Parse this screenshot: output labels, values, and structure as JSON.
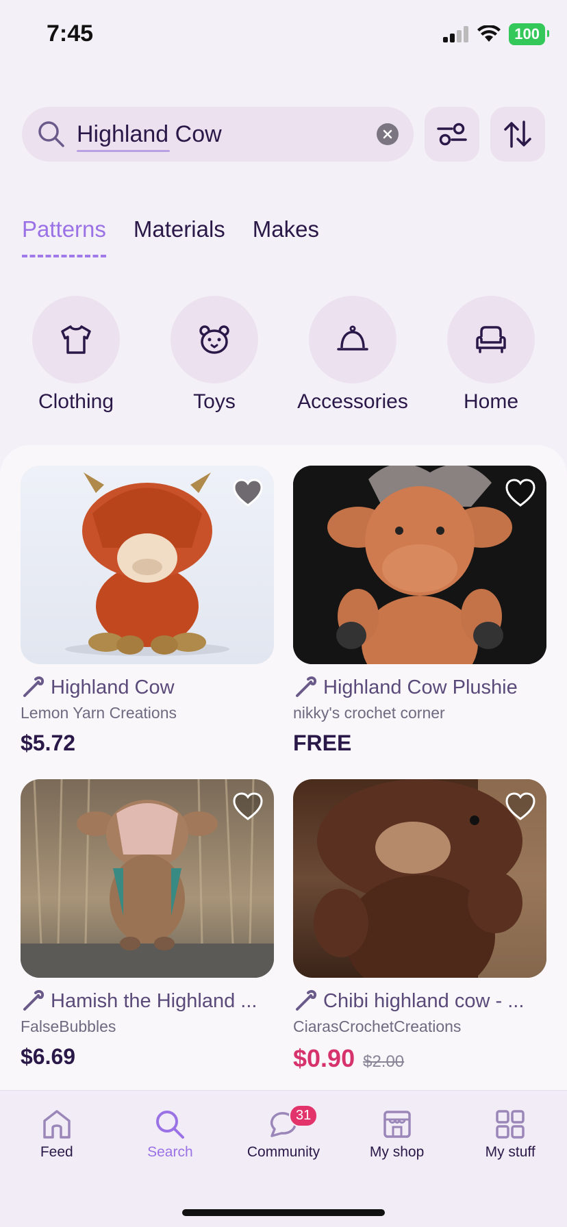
{
  "status": {
    "time": "7:45",
    "battery": "100"
  },
  "search": {
    "query": "Highland Cow"
  },
  "tabs": [
    {
      "label": "Patterns",
      "active": true
    },
    {
      "label": "Materials",
      "active": false
    },
    {
      "label": "Makes",
      "active": false
    }
  ],
  "categories": [
    {
      "label": "Clothing",
      "icon": "shirt-icon"
    },
    {
      "label": "Toys",
      "icon": "bear-icon"
    },
    {
      "label": "Accessories",
      "icon": "bell-icon"
    },
    {
      "label": "Home",
      "icon": "couch-icon"
    }
  ],
  "results": [
    {
      "title": "Highland Cow",
      "author": "Lemon Yarn Creations",
      "price": "$5.72",
      "old_price": "",
      "favorited": true
    },
    {
      "title": "Highland Cow Plushie",
      "author": "nikky's crochet corner",
      "price": "FREE",
      "old_price": "",
      "favorited": false
    },
    {
      "title": "Hamish the Highland ...",
      "author": "FalseBubbles",
      "price": "$6.69",
      "old_price": "",
      "favorited": false
    },
    {
      "title": "Chibi highland cow - ...",
      "author": "CiarasCrochetCreations",
      "price": "$0.90",
      "old_price": "$2.00",
      "favorited": false
    }
  ],
  "nav": [
    {
      "label": "Feed",
      "icon": "home-icon",
      "active": false
    },
    {
      "label": "Search",
      "icon": "search-icon",
      "active": true
    },
    {
      "label": "Community",
      "icon": "chat-icon",
      "active": false,
      "badge": "31"
    },
    {
      "label": "My shop",
      "icon": "shop-icon",
      "active": false
    },
    {
      "label": "My stuff",
      "icon": "grid-icon",
      "active": false
    }
  ],
  "colors": {
    "accent": "#9a72e6",
    "sale": "#d6336c",
    "primary_text": "#2a1848"
  }
}
